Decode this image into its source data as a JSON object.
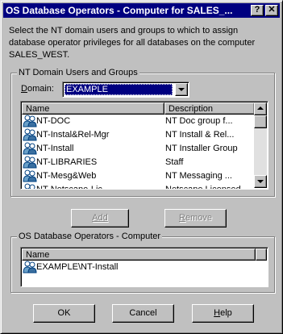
{
  "window": {
    "title": "OS Database Operators - Computer for SALES_...",
    "help_glyph": "?",
    "close_glyph": "✕"
  },
  "description": "Select the NT domain users and groups to which to assign database operator privileges for all databases on the computer SALES_WEST.",
  "nt_group": {
    "label": "NT Domain Users and Groups",
    "domain_label": "Domain:",
    "domain_value": "EXAMPLE",
    "columns": [
      "Name",
      "Description"
    ],
    "rows": [
      {
        "name": "NT-DOC",
        "description": "NT Doc group f..."
      },
      {
        "name": "NT-Instal&Rel-Mgr",
        "description": "NT Install & Rel..."
      },
      {
        "name": "NT-Install",
        "description": "NT Installer Group"
      },
      {
        "name": "NT-LIBRARIES",
        "description": "Staff"
      },
      {
        "name": "NT-Mesg&Web",
        "description": "NT Messaging ..."
      },
      {
        "name": "NT-Netscape-Lic",
        "description": "Netscape Licensed"
      }
    ]
  },
  "buttons": {
    "add": "Add",
    "remove": "Remove",
    "ok": "OK",
    "cancel": "Cancel",
    "help": "Help"
  },
  "operators_group": {
    "label": "OS Database Operators - Computer",
    "column": "Name",
    "rows": [
      {
        "name": "EXAMPLE\\NT-Install"
      }
    ]
  },
  "icons": {
    "group": "user-group-icon"
  }
}
